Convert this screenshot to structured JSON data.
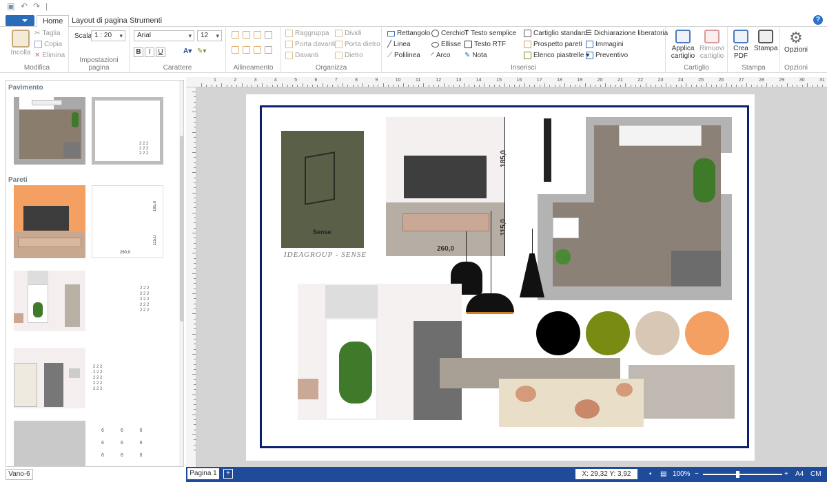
{
  "ribbon": {
    "tabs": [
      "Home",
      "Layout di pagina",
      "Strumenti"
    ],
    "modifica": {
      "incolla": "Incolla",
      "taglia": "Taglia",
      "copia": "Copia",
      "elimina": "Elimina",
      "label": "Modifica"
    },
    "impostazioni": {
      "scala_label": "Scala",
      "scala_value": "1 : 20",
      "label": "Impostazioni pagina"
    },
    "carattere": {
      "font": "Arial",
      "size": "12",
      "bold": "B",
      "italic": "I",
      "underline": "U",
      "label": "Carattere"
    },
    "allineamento": {
      "label": "Allineamento"
    },
    "organizza": {
      "raggruppa": "Raggruppa",
      "dividi": "Dividi",
      "porta_davanti": "Porta davanti",
      "porta_dietro": "Porta dietro",
      "davanti": "Davanti",
      "dietro": "Dietro",
      "label": "Organizza"
    },
    "inserisci": {
      "rettangolo": "Rettangolo",
      "cerchio": "Cerchio",
      "testo_semplice": "Testo semplice",
      "linea": "Linea",
      "ellisse": "Ellisse",
      "testo_rtf": "Testo RTF",
      "polilinea": "Polilinea",
      "arco": "Arco",
      "nota": "Nota",
      "cartiglio_standard": "Cartiglio standard",
      "dichiarazione": "Dichiarazione liberatoria",
      "prospetto_pareti": "Prospetto pareti",
      "immagini": "Immagini",
      "elenco_piastrelle": "Elenco piastrelle",
      "preventivo": "Preventivo",
      "label": "Inserisci"
    },
    "cartiglio": {
      "applica": "Applica cartiglio",
      "rimuovi": "Rimuovi cartiglio",
      "label": "Cartiglio"
    },
    "stampa": {
      "crea_pdf": "Crea PDF",
      "stampa": "Stampa",
      "label": "Stampa"
    },
    "opzioni": {
      "opzioni": "Opzioni",
      "label": "Opzioni"
    }
  },
  "left_panel": {
    "sections": [
      "Pavimento",
      "Pareti"
    ]
  },
  "canvas": {
    "dim_height_top": "185,0",
    "dim_height_bottom": "115,0",
    "dim_width": "260,0",
    "brand_caption": "IDEAGROUP - SENSE",
    "poster_text": "Sense",
    "palette": [
      "#000000",
      "#7a8b14",
      "#d8c7b4",
      "#f3a062"
    ]
  },
  "thumbs": {
    "pareti_dim_h1": "185,0",
    "pareti_dim_h2": "115,0",
    "pareti_dim_w": "260,0",
    "pareti_dim_h1_small": "185,0",
    "pareti_dim_h2_small": "115,0",
    "pareti_dim_w_small": "260,0"
  },
  "ruler": {
    "labels": [
      "1",
      "2",
      "3",
      "4",
      "5",
      "6",
      "7",
      "8",
      "9",
      "10",
      "11",
      "12",
      "13",
      "14",
      "15",
      "16",
      "17",
      "18",
      "19",
      "20",
      "21",
      "22",
      "23",
      "24",
      "25",
      "26",
      "27",
      "28",
      "29",
      "30",
      "31"
    ]
  },
  "status": {
    "page_tab": "Pagina 1",
    "coords": "X: 29,32   Y: 3,92",
    "zoom": "100%",
    "paper": "A4",
    "unit": "CM",
    "minus": "−",
    "plus": "+"
  },
  "bottom_tab": "Vano-6"
}
